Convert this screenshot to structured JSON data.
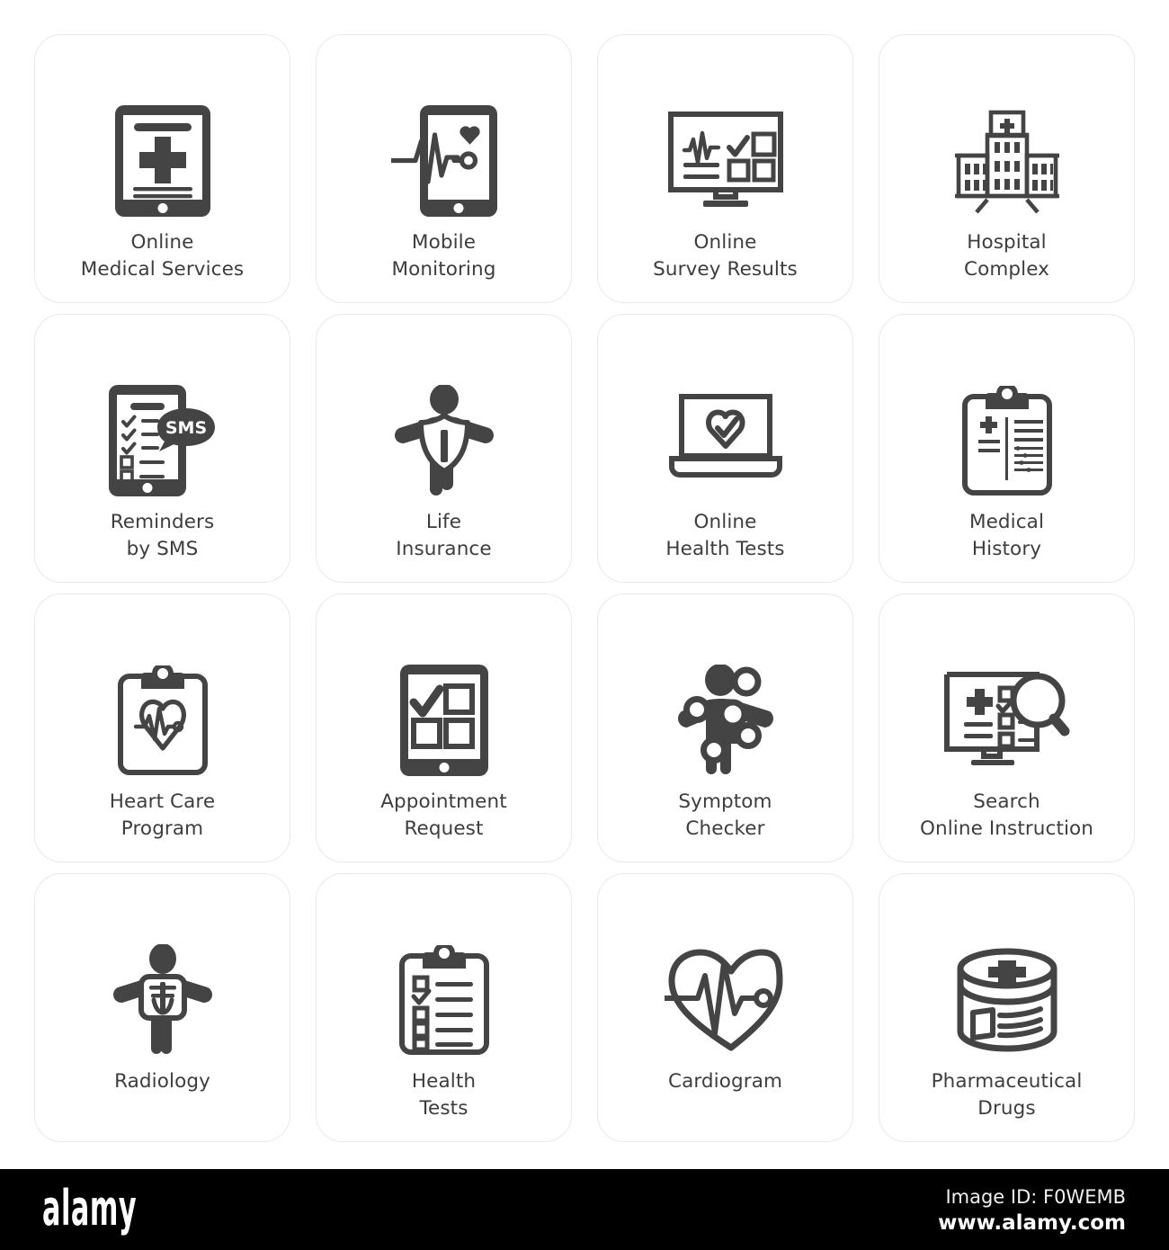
{
  "page": {
    "background": "#ffffff",
    "tile_border_color": "#e9e9e9",
    "icon_color": "#444444",
    "label_color": "#3d3d3d"
  },
  "grid": {
    "columns": 4,
    "rows": 4,
    "tiles": [
      {
        "id": "online-medical-services",
        "label": "Online\nMedical Services",
        "icon": "tablet-medical-cross-icon"
      },
      {
        "id": "mobile-monitoring",
        "label": "Mobile\nMonitoring",
        "icon": "smartphone-heartbeat-icon"
      },
      {
        "id": "online-survey-results",
        "label": "Online\nSurvey Results",
        "icon": "monitor-survey-checkbox-icon"
      },
      {
        "id": "hospital-complex",
        "label": "Hospital\nComplex",
        "icon": "hospital-building-icon"
      },
      {
        "id": "reminders-by-sms",
        "label": "Reminders\nby SMS",
        "icon": "smartphone-sms-checklist-icon"
      },
      {
        "id": "life-insurance",
        "label": "Life\nInsurance",
        "icon": "person-shield-icon"
      },
      {
        "id": "online-health-tests",
        "label": "Online\nHealth Tests",
        "icon": "laptop-heart-check-icon"
      },
      {
        "id": "medical-history",
        "label": "Medical\nHistory",
        "icon": "clipboard-medical-record-icon"
      },
      {
        "id": "heart-care-program",
        "label": "Heart Care\nProgram",
        "icon": "clipboard-heart-pulse-icon"
      },
      {
        "id": "appointment-request",
        "label": "Appointment\nRequest",
        "icon": "tablet-checkbox-grid-icon"
      },
      {
        "id": "symptom-checker",
        "label": "Symptom\nChecker",
        "icon": "person-pain-points-icon"
      },
      {
        "id": "search-online-instruction",
        "label": "Search\nOnline Instruction",
        "icon": "monitor-magnifier-icon"
      },
      {
        "id": "radiology",
        "label": "Radiology",
        "icon": "person-xray-chest-icon"
      },
      {
        "id": "health-tests",
        "label": "Health\nTests",
        "icon": "clipboard-checklist-icon"
      },
      {
        "id": "cardiogram",
        "label": "Cardiogram",
        "icon": "heart-cardiogram-icon"
      },
      {
        "id": "pharmaceutical-drugs",
        "label": "Pharmaceutical\nDrugs",
        "icon": "medicine-jar-cross-icon"
      }
    ]
  },
  "sms_bubble_text": "SMS",
  "footer": {
    "logo": "alamy",
    "image_id": "Image ID: F0WEMB",
    "url": "www.alamy.com",
    "background": "#000000",
    "text_color": "#ffffff"
  }
}
